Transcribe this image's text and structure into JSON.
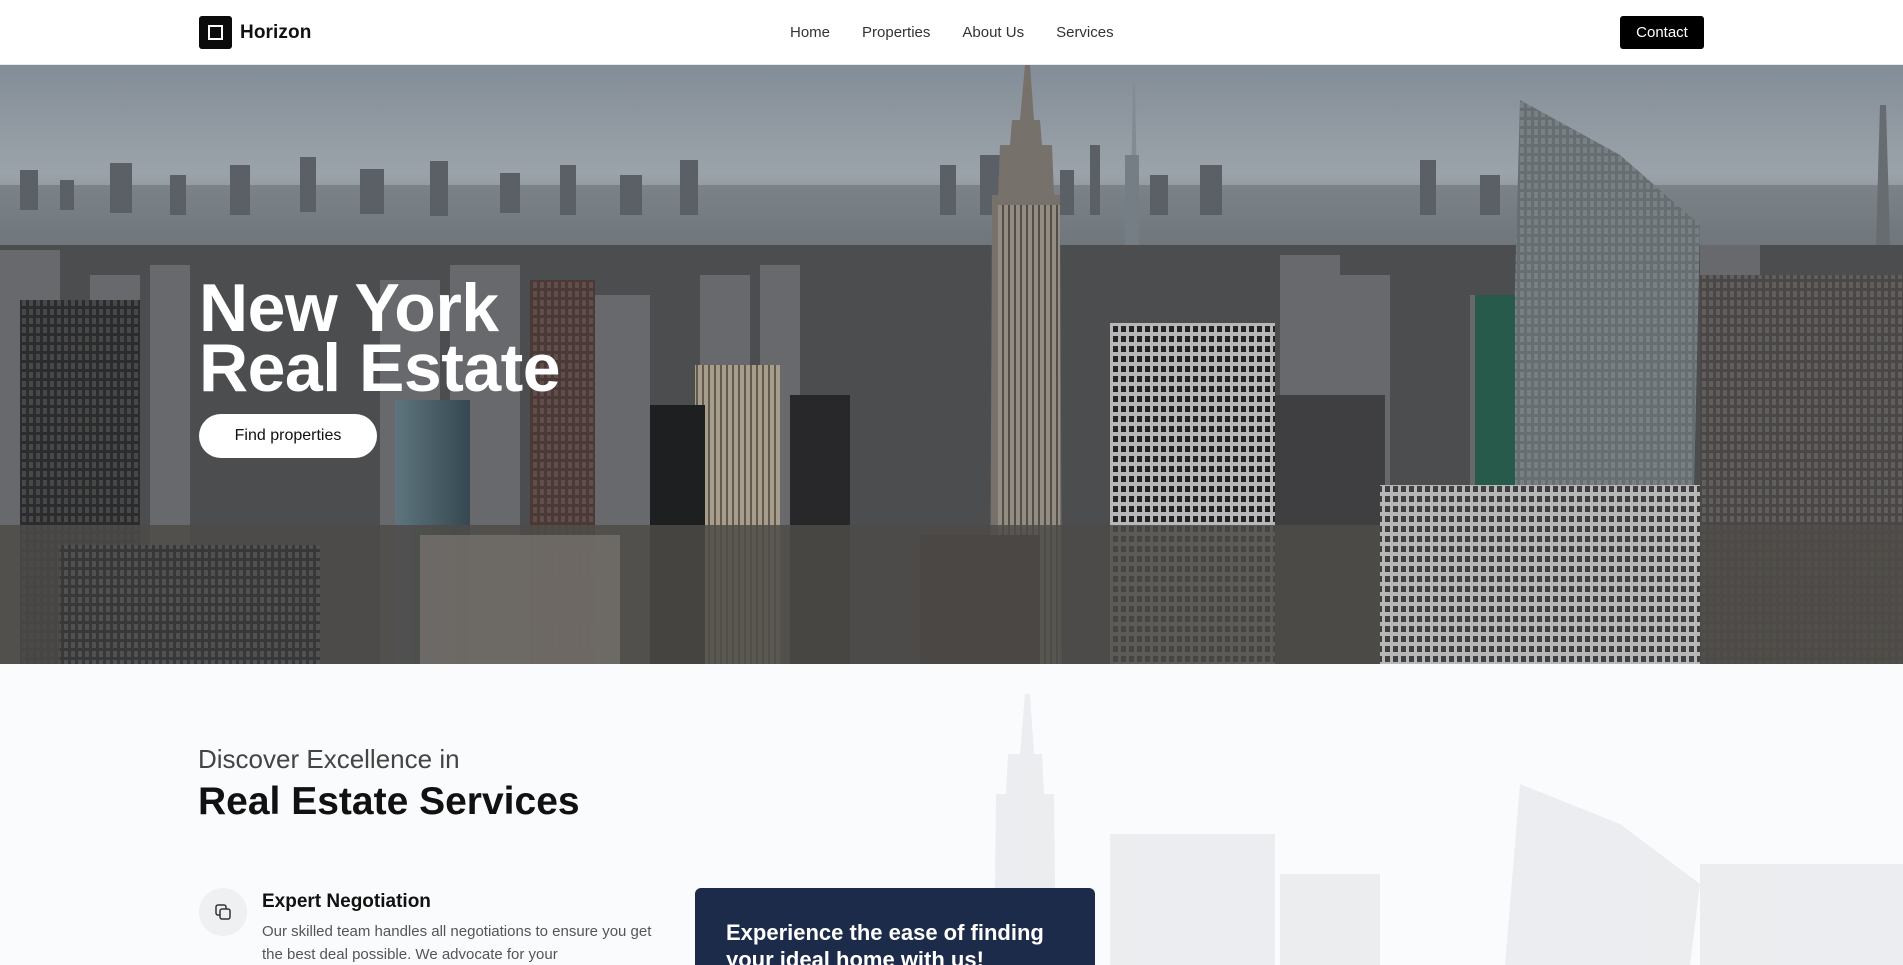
{
  "header": {
    "brand_name": "Horizon",
    "brand_icon": "square-logo-icon",
    "nav": [
      "Home",
      "Properties",
      "About Us",
      "Services"
    ],
    "contact_label": "Contact"
  },
  "hero": {
    "title_line1": "New York",
    "title_line2": "Real Estate",
    "cta_label": "Find properties"
  },
  "services": {
    "subtitle": "Discover Excellence in",
    "title": "Real Estate Services",
    "feature": {
      "icon": "copy-icon",
      "title": "Expert Negotiation",
      "description": "Our skilled team handles all negotiations to ensure you get the best deal possible. We advocate for your"
    },
    "promo_text": "Experience the ease of finding your ideal home with us!"
  },
  "colors": {
    "brand_dark": "#0b0b0c",
    "promo_bg": "#1c2b49",
    "button_black": "#000000",
    "white": "#ffffff"
  }
}
